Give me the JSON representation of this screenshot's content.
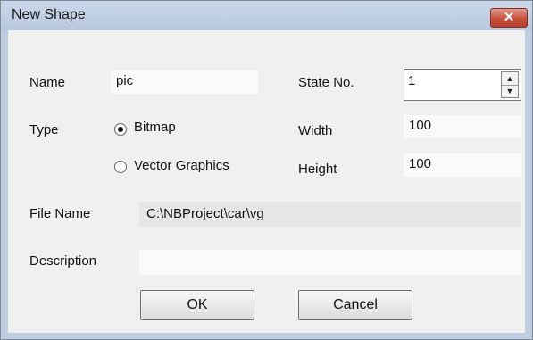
{
  "window": {
    "title": "New Shape",
    "close_glyph": "✕"
  },
  "labels": {
    "name": "Name",
    "type": "Type",
    "state_no": "State No.",
    "width": "Width",
    "height": "Height",
    "file_name": "File Name",
    "description": "Description"
  },
  "fields": {
    "name": "pic",
    "state_no": "1",
    "width": "100",
    "height": "100",
    "file_name": "C:\\NBProject\\car\\vg",
    "description": ""
  },
  "type_options": [
    {
      "label": "Bitmap",
      "selected": true
    },
    {
      "label": "Vector Graphics",
      "selected": false
    }
  ],
  "buttons": {
    "ok": "OK",
    "cancel": "Cancel"
  },
  "icons": {
    "spin_up": "▲",
    "spin_down": "▼"
  },
  "colors": {
    "titlebar": "#bfcde0",
    "close_button": "#c7503d",
    "client": "#f0f0f0"
  }
}
